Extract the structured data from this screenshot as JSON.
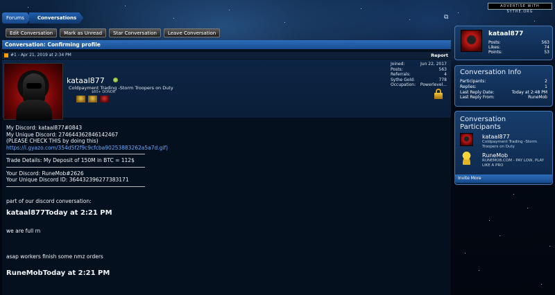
{
  "header": {
    "breadcrumbs": [
      "Forums",
      "Conversations"
    ],
    "ad_text": "ADVERTISE WITH SYTHE.ORG"
  },
  "actions": [
    "Edit Conversation",
    "Mark as Unread",
    "Star Conversation",
    "Leave Conversation"
  ],
  "thread": {
    "title": "Conversation: Confirming profile",
    "post_meta": "#1 - Apr 21, 2019 at 2:34 PM",
    "report": "Report"
  },
  "author": {
    "name": "kataal877",
    "title": "Coldpayment Trading -Storm Troopers on Duty",
    "badge": "$60+ DONOR",
    "stats": [
      {
        "label": "Joined:",
        "value": "Jun 22, 2017"
      },
      {
        "label": "Posts:",
        "value": "563"
      },
      {
        "label": "Referrals:",
        "value": "4"
      },
      {
        "label": "Sythe Gold:",
        "value": "778"
      },
      {
        "label": "Occupation:",
        "value": "Powerlevel..."
      }
    ]
  },
  "message": {
    "lines1": [
      "My Discord: kataal877#0843",
      "My Unique Discord: 274644362846142467",
      "(PLEASE CHECK THIS by doing this)"
    ],
    "link": "https://i.gyazo.com/354d5f2f9c9cfcba90253883262a5a7d.gif)",
    "trade": "Trade Details: My Deposit of 150M in BTC = 112$",
    "lines2": [
      "Your Discord: RuneMob#2626",
      "Your Unique Discord ID: 364432396277383171"
    ],
    "part_of": "part of our discord conversation:",
    "h1": "kataal877Today at 2:21 PM",
    "l1": "we are full rn",
    "l2": "asap workers finish some nmz orders",
    "h2": "RuneMobToday at 2:21 PM"
  },
  "sidebar": {
    "profile": {
      "name": "kataal877",
      "stats": [
        {
          "label": "Posts:",
          "value": "563"
        },
        {
          "label": "Likes:",
          "value": "74"
        },
        {
          "label": "Points:",
          "value": "53"
        }
      ]
    },
    "info": {
      "heading": "Conversation Info",
      "rows": [
        {
          "label": "Participants:",
          "value": "2"
        },
        {
          "label": "Replies:",
          "value": "1"
        },
        {
          "label": "Last Reply Date:",
          "value": "Today at 2:48 PM"
        },
        {
          "label": "Last Reply From:",
          "value": "RuneMob"
        }
      ]
    },
    "participants": {
      "heading": "Conversation Participants",
      "list": [
        {
          "name": "kataal877",
          "title": "Coldpayment Trading -Storm Troopers on Duty"
        },
        {
          "name": "RuneMob",
          "title": "RUNEMOB.COM - PAY LOW, PLAY LIKE A PRO"
        }
      ],
      "invite": "Invite More"
    }
  }
}
